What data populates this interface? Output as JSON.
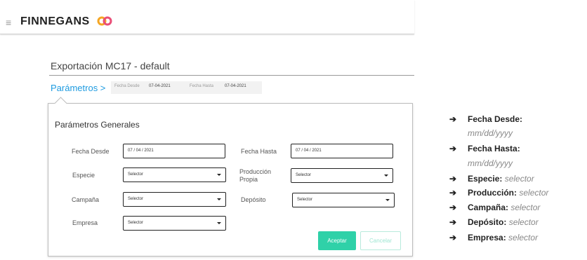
{
  "header": {
    "menu_glyph": "≡",
    "brand": "FINNEGANS",
    "brand_colors": [
      "#f5a623",
      "#e94e77"
    ]
  },
  "page": {
    "title": "Exportación MC17 - default"
  },
  "breadcrumb": {
    "params_label": "Parámetros >",
    "chips": [
      {
        "label": "Fecha Desde",
        "value": "07-04-2021"
      },
      {
        "label": "Fecha Hasta",
        "value": "07-04-2021"
      }
    ]
  },
  "panel": {
    "title": "Parámetros Generales",
    "fields": {
      "fecha_desde": {
        "label": "Fecha Desde",
        "value": "07 / 04 / 2021"
      },
      "fecha_hasta": {
        "label": "Fecha Hasta",
        "value": "07 / 04 / 2021"
      },
      "especie": {
        "label": "Especie",
        "value": "Selector"
      },
      "produccion": {
        "label": "Producción Propia",
        "value": "Selector"
      },
      "campana": {
        "label": "Campaña",
        "value": "Selector"
      },
      "deposito": {
        "label": "Depósito",
        "value": "Selector"
      },
      "empresa": {
        "label": "Empresa",
        "value": "Selector"
      }
    },
    "accept_label": "Aceptar",
    "cancel_label": "Cancelar"
  },
  "notes": [
    {
      "key": "Fecha Desde:",
      "value": "mm/dd/yyyy",
      "wrap": true
    },
    {
      "key": "Fecha Hasta:",
      "value": "mm/dd/yyyy",
      "wrap": true
    },
    {
      "key": "Especie:",
      "value": "selector"
    },
    {
      "key": "Producción:",
      "value": "selector"
    },
    {
      "key": "Campaña:",
      "value": "selector"
    },
    {
      "key": "Depósito:",
      "value": "selector"
    },
    {
      "key": "Empresa:",
      "value": "selector"
    }
  ],
  "arrow_glyph": "➔"
}
